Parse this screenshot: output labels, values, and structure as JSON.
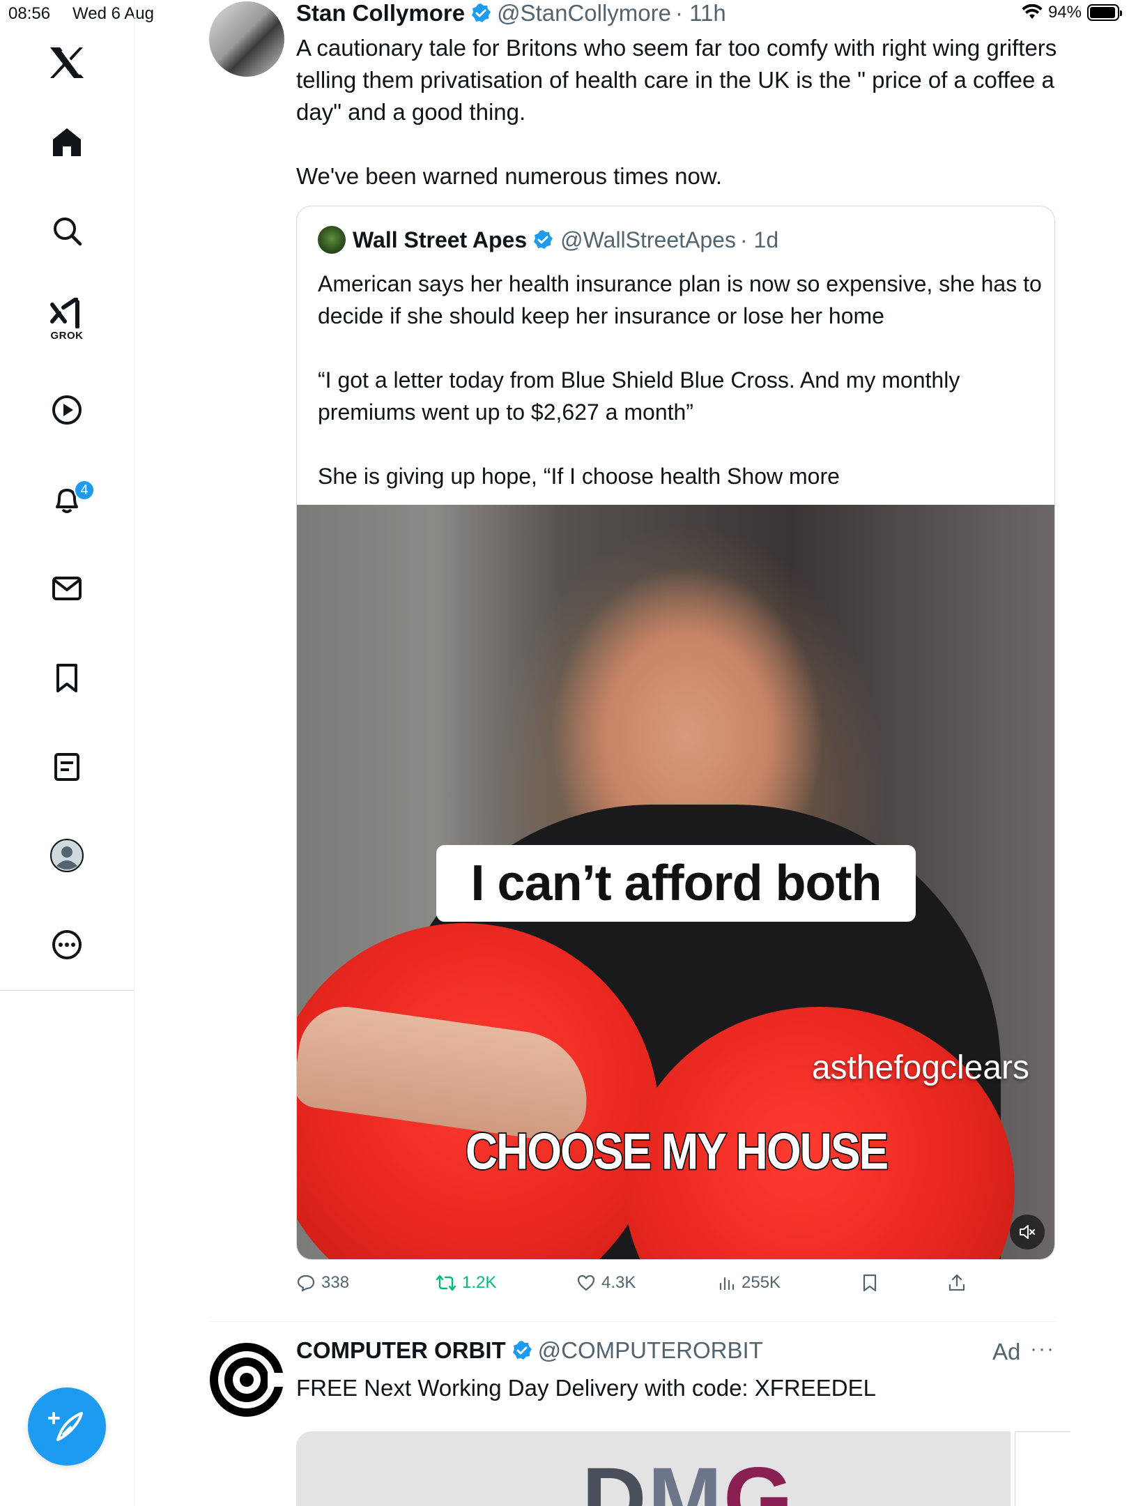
{
  "status_bar": {
    "time": "08:56",
    "date": "Wed 6 Aug",
    "battery": "94%",
    "battery_level": 0.94
  },
  "sidebar": {
    "items": [
      {
        "name": "x-logo",
        "icon": "x-logo-icon"
      },
      {
        "name": "home",
        "icon": "home-icon"
      },
      {
        "name": "explore",
        "icon": "search-icon"
      },
      {
        "name": "grok",
        "icon": "grok-icon",
        "label": "GROK"
      },
      {
        "name": "videos",
        "icon": "play-icon"
      },
      {
        "name": "notifications",
        "icon": "bell-icon",
        "badge": "4"
      },
      {
        "name": "messages",
        "icon": "envelope-icon"
      },
      {
        "name": "bookmarks",
        "icon": "bookmark-icon"
      },
      {
        "name": "lists",
        "icon": "list-icon"
      },
      {
        "name": "profile",
        "icon": "profile-icon"
      },
      {
        "name": "more",
        "icon": "more-circle-icon"
      }
    ],
    "compose_icon": "compose-icon"
  },
  "colors": {
    "accent": "#1d9bf0",
    "text": "#0f1419",
    "secondary": "#536471",
    "retweet_active": "#00ba7c"
  },
  "tweet": {
    "author_name": "Stan Collymore",
    "handle": "@StanCollymore",
    "time": "· 11h",
    "text_1": "A cautionary tale for Britons who seem far too comfy with right wing grifters telling them privatisation of health care in the UK is the \" price of a coffee a day\" and a good thing.",
    "text_2": "We've been warned numerous times now.",
    "quote": {
      "author_name": "Wall Street Apes",
      "handle": "@WallStreetApes",
      "time": "· 1d",
      "text_1": "American says her health insurance plan is now so expensive, she has to decide if she should keep her insurance or lose her home",
      "text_2": "“I got a letter today from Blue Shield Blue Cross. And my monthly premiums went up to $2,627 a month”",
      "text_3": "She is giving up hope, “If I choose health",
      "show_more": "Show more",
      "video": {
        "caption": "I can’t afford both",
        "watermark": "asthefogclears",
        "subtitle": "CHOOSE MY HOUSE",
        "mute_icon": "speaker-muted-icon"
      }
    },
    "actions": {
      "replies": "338",
      "reposts": "1.2K",
      "likes": "4.3K",
      "views": "255K"
    }
  },
  "ad": {
    "author_name": "COMPUTER ORBIT",
    "handle": "@COMPUTERORBIT",
    "ad_label": "Ad",
    "more": "···",
    "text": "FREE Next Working Day Delivery with code: XFREEDEL",
    "card_logo_d": "D",
    "card_logo_m": "M",
    "card_logo_g": "G"
  }
}
